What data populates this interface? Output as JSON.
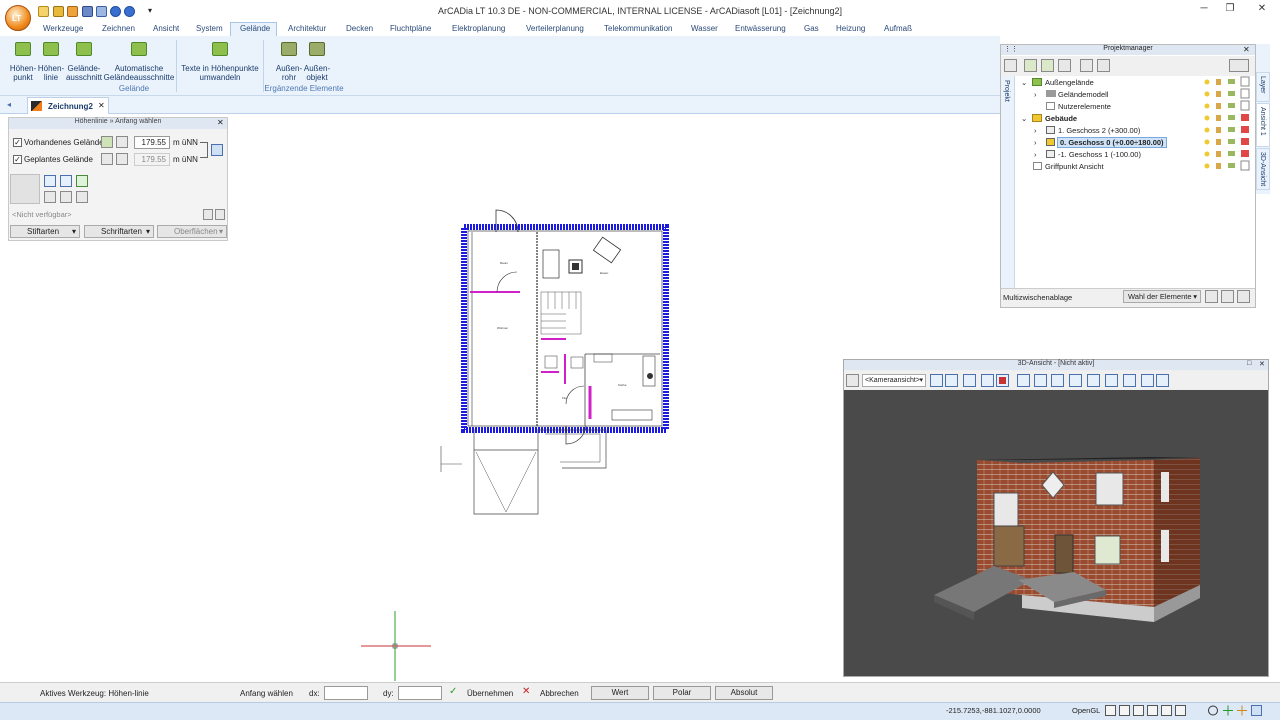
{
  "app": {
    "title": "ArCADia LT 10.3 DE - NON-COMMERCIAL, INTERNAL LICENSE - ArCADiasoft [L01] - [Zeichnung2]",
    "logo_text": "LT"
  },
  "menu": [
    "Werkzeuge",
    "Zeichnen",
    "Ansicht",
    "System",
    "Gelände",
    "Architektur",
    "Decken",
    "Fluchtpläne",
    "Elektroplanung",
    "Verteilerplanung",
    "Telekommunikation",
    "Wasser",
    "Entwässerung",
    "Gas",
    "Heizung",
    "Aufmaß"
  ],
  "ribbon": {
    "items": [
      {
        "l1": "Höhen-",
        "l2": "punkt"
      },
      {
        "l1": "Höhen-",
        "l2": "linie"
      },
      {
        "l1": "Gelände-",
        "l2": "ausschnitt"
      },
      {
        "l1": "Automatische",
        "l2": "Geländeausschnitte"
      },
      {
        "l1": "Texte in Höhenpunkte",
        "l2": "umwandeln"
      },
      {
        "l1": "Außen-",
        "l2": "rohr"
      },
      {
        "l1": "Außen-",
        "l2": "objekt"
      }
    ],
    "group1": "Gelände",
    "group2": "Ergänzende Elemente"
  },
  "doc_tab": "Zeichnung2",
  "tool_panel": {
    "header": "Höhenlinie » Anfang wählen",
    "existing_label": "Vorhandenes Gelände",
    "existing_value": "179.55",
    "planned_label": "Geplantes Gelände",
    "planned_value": "179.55",
    "unit": "m üNN",
    "not_available": "<Nicht verfügbar>",
    "btn1": "Stiftarten",
    "btn2": "Schriftarten",
    "btn3": "Oberflächen"
  },
  "project_manager": {
    "header": "Projektmanager",
    "side_tab": "Projekt",
    "tree": [
      "Außengelände",
      "Geländemodell",
      "Nutzerelemente",
      "Gebäude",
      "1. Geschoss 2 (+300.00)",
      "0. Geschoss 0 (+0.00÷180.00)",
      "-1. Geschoss 1 (-100.00)",
      "Griffpunkt Ansicht"
    ],
    "bottom_label": "Multizwischenablage",
    "select_value": "Wahl der Elemente"
  },
  "side_tabs": [
    "Layer",
    "Ansicht 1",
    "3D-Ansicht"
  ],
  "view3d": {
    "header": "3D-Ansicht - [Nicht aktiv]",
    "camera": "<Kameraansicht>"
  },
  "status": {
    "tool": "Aktives Werkzeug: Höhen-linie",
    "prompt": "Anfang wählen",
    "dx": "dx:",
    "dy": "dy:",
    "accept": "Übernehmen",
    "cancel": "Abbrechen",
    "mode1": "Wert",
    "mode2": "Polar",
    "mode3": "Absolut"
  },
  "bottom": {
    "coords": "-215.7253,-881.1027,0.0000",
    "renderer": "OpenGL"
  },
  "colors": {
    "ribbon_bg": "#eaf3fc",
    "accent": "#2b4a7a",
    "wall_blue": "#1a1ae0",
    "door_magenta": "#d020c8"
  }
}
